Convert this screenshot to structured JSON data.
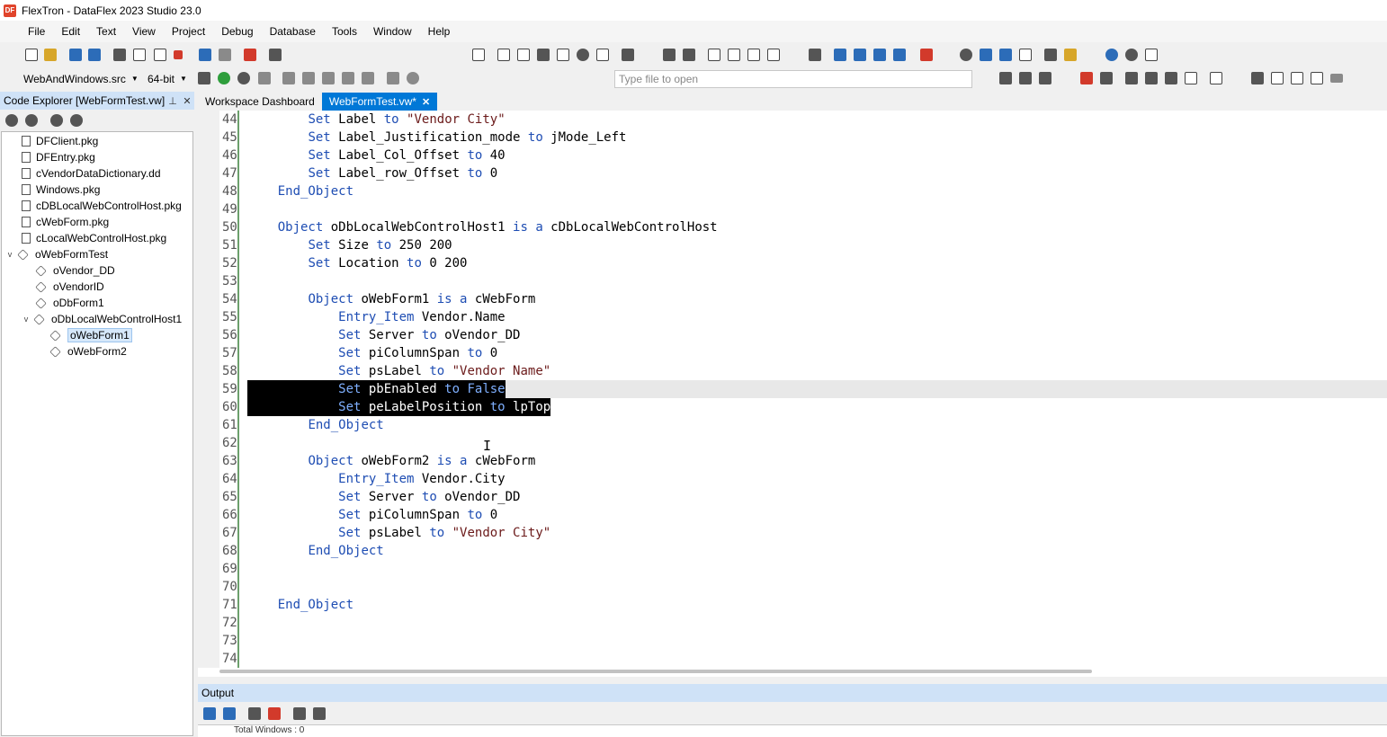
{
  "window": {
    "title": "FlexTron - DataFlex 2023 Studio 23.0",
    "icon": "app-icon",
    "icon_text": "DF"
  },
  "menu": [
    "File",
    "Edit",
    "Text",
    "View",
    "Project",
    "Debug",
    "Database",
    "Tools",
    "Window",
    "Help"
  ],
  "toolbar": {
    "workspace_combo": "WebAndWindows.src",
    "bitness_combo": "64-bit",
    "type_file_placeholder": "Type file to open"
  },
  "code_explorer": {
    "title": "Code Explorer [WebFormTest.vw]",
    "items": [
      {
        "label": "DFClient.pkg",
        "kind": "file",
        "level": 0
      },
      {
        "label": "DFEntry.pkg",
        "kind": "file",
        "level": 0
      },
      {
        "label": "cVendorDataDictionary.dd",
        "kind": "file",
        "level": 0
      },
      {
        "label": "Windows.pkg",
        "kind": "file",
        "level": 0
      },
      {
        "label": "cDBLocalWebControlHost.pkg",
        "kind": "file",
        "level": 0
      },
      {
        "label": "cWebForm.pkg",
        "kind": "file",
        "level": 0
      },
      {
        "label": "cLocalWebControlHost.pkg",
        "kind": "file",
        "level": 0
      },
      {
        "label": "oWebFormTest",
        "kind": "object",
        "level": 0,
        "expanded": true
      },
      {
        "label": "oVendor_DD",
        "kind": "object",
        "level": 1
      },
      {
        "label": "oVendorID",
        "kind": "object",
        "level": 1
      },
      {
        "label": "oDbForm1",
        "kind": "object",
        "level": 1
      },
      {
        "label": "oDbLocalWebControlHost1",
        "kind": "object",
        "level": 1,
        "expanded": true
      },
      {
        "label": "oWebForm1",
        "kind": "object",
        "level": 2,
        "selected": true
      },
      {
        "label": "oWebForm2",
        "kind": "object",
        "level": 2
      }
    ]
  },
  "tabs": [
    {
      "label": "Workspace Dashboard",
      "active": false
    },
    {
      "label": "WebFormTest.vw*",
      "active": true
    }
  ],
  "editor": {
    "lines": [
      {
        "n": "44",
        "code": "        Set Label to \"Vendor City\""
      },
      {
        "n": "45",
        "code": "        Set Label_Justification_mode to jMode_Left"
      },
      {
        "n": "46",
        "code": "        Set Label_Col_Offset to 40"
      },
      {
        "n": "47",
        "code": "        Set Label_row_Offset to 0"
      },
      {
        "n": "48",
        "code": "    End_Object"
      },
      {
        "n": "49",
        "code": ""
      },
      {
        "n": "50",
        "code": "    Object oDbLocalWebControlHost1 is a cDbLocalWebControlHost"
      },
      {
        "n": "51",
        "code": "        Set Size to 250 200"
      },
      {
        "n": "52",
        "code": "        Set Location to 0 200"
      },
      {
        "n": "53",
        "code": ""
      },
      {
        "n": "54",
        "code": "        Object oWebForm1 is a cWebForm"
      },
      {
        "n": "55",
        "code": "            Entry_Item Vendor.Name"
      },
      {
        "n": "56",
        "code": "            Set Server to oVendor_DD"
      },
      {
        "n": "57",
        "code": "            Set piColumnSpan to 0"
      },
      {
        "n": "58",
        "code": "            Set psLabel to \"Vendor Name\""
      },
      {
        "n": "59",
        "code": "            Set pbEnabled to False"
      },
      {
        "n": "60",
        "code": "            Set peLabelPosition to lpTop"
      },
      {
        "n": "61",
        "code": "        End_Object"
      },
      {
        "n": "62",
        "code": ""
      },
      {
        "n": "63",
        "code": "        Object oWebForm2 is a cWebForm"
      },
      {
        "n": "64",
        "code": "            Entry_Item Vendor.City"
      },
      {
        "n": "65",
        "code": "            Set Server to oVendor_DD"
      },
      {
        "n": "66",
        "code": "            Set piColumnSpan to 0"
      },
      {
        "n": "67",
        "code": "            Set psLabel to \"Vendor City\""
      },
      {
        "n": "68",
        "code": "        End_Object"
      },
      {
        "n": "69",
        "code": ""
      },
      {
        "n": "70",
        "code": ""
      },
      {
        "n": "71",
        "code": "    End_Object"
      },
      {
        "n": "72",
        "code": ""
      },
      {
        "n": "73",
        "code": ""
      },
      {
        "n": "74",
        "code": ""
      }
    ]
  },
  "output": {
    "title": "Output",
    "first_line": "Total Windows : 0"
  }
}
